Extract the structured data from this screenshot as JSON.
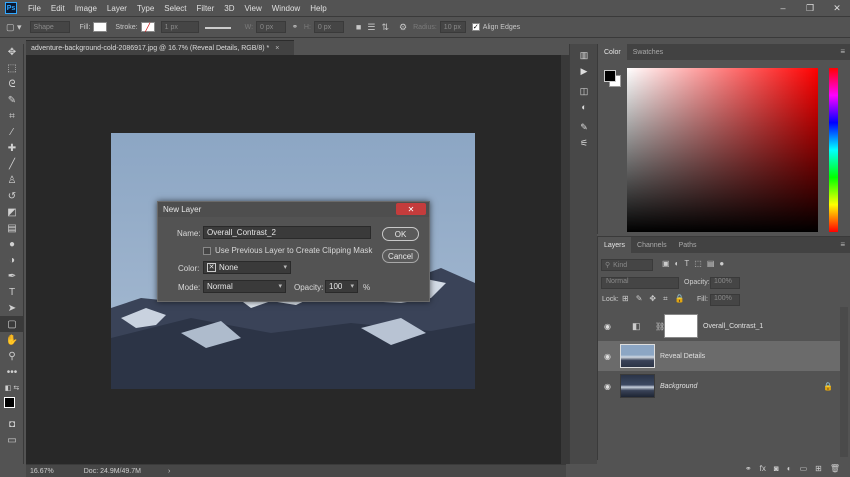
{
  "menubar": {
    "logo": "Ps",
    "items": [
      "File",
      "Edit",
      "Image",
      "Layer",
      "Type",
      "Select",
      "Filter",
      "3D",
      "View",
      "Window",
      "Help"
    ],
    "controls": [
      "–",
      "❐",
      "✕"
    ]
  },
  "options_bar": {
    "mode": "Shape",
    "fill_label": "Fill:",
    "stroke_label": "Stroke:",
    "stroke_width": "1 px",
    "w_label": "W:",
    "w_value": "0 px",
    "h_label": "H:",
    "h_value": "0 px",
    "radius_label": "Radius:",
    "radius_value": "10 px",
    "align_edges": "Align Edges"
  },
  "document_tab": {
    "title": "adventure-background-cold-2086917.jpg @ 16.7% (Reveal Details, RGB/8) *",
    "close": "×"
  },
  "status_bar": {
    "zoom": "16.67%",
    "doc": "Doc: 24.9M/49.7M",
    "arrow": "›"
  },
  "dialog": {
    "title": "New Layer",
    "close": "✕",
    "name_label": "Name:",
    "name_value": "Overall_Contrast_2",
    "clip_label": "Use Previous Layer to Create Clipping Mask",
    "color_label": "Color:",
    "color_value": "None",
    "mode_label": "Mode:",
    "mode_value": "Normal",
    "opacity_label": "Opacity:",
    "opacity_value": "100",
    "opacity_unit": "%",
    "ok": "OK",
    "cancel": "Cancel"
  },
  "color_panel": {
    "tabs": [
      "Color",
      "Swatches"
    ],
    "menu": "≡",
    "hue_color": "#ff0000"
  },
  "layers_panel": {
    "tabs": [
      "Layers",
      "Channels",
      "Paths"
    ],
    "menu": "≡",
    "filter": "Kind",
    "blend_mode": "Normal",
    "opacity_label": "Opacity:",
    "opacity_value": "100%",
    "lock_label": "Lock:",
    "fill_label": "Fill:",
    "fill_value": "100%",
    "layers": [
      {
        "name": "Overall_Contrast_1",
        "selected": false,
        "italic": false
      },
      {
        "name": "Reveal Details",
        "selected": true,
        "italic": false
      },
      {
        "name": "Background",
        "selected": false,
        "italic": true
      }
    ]
  }
}
